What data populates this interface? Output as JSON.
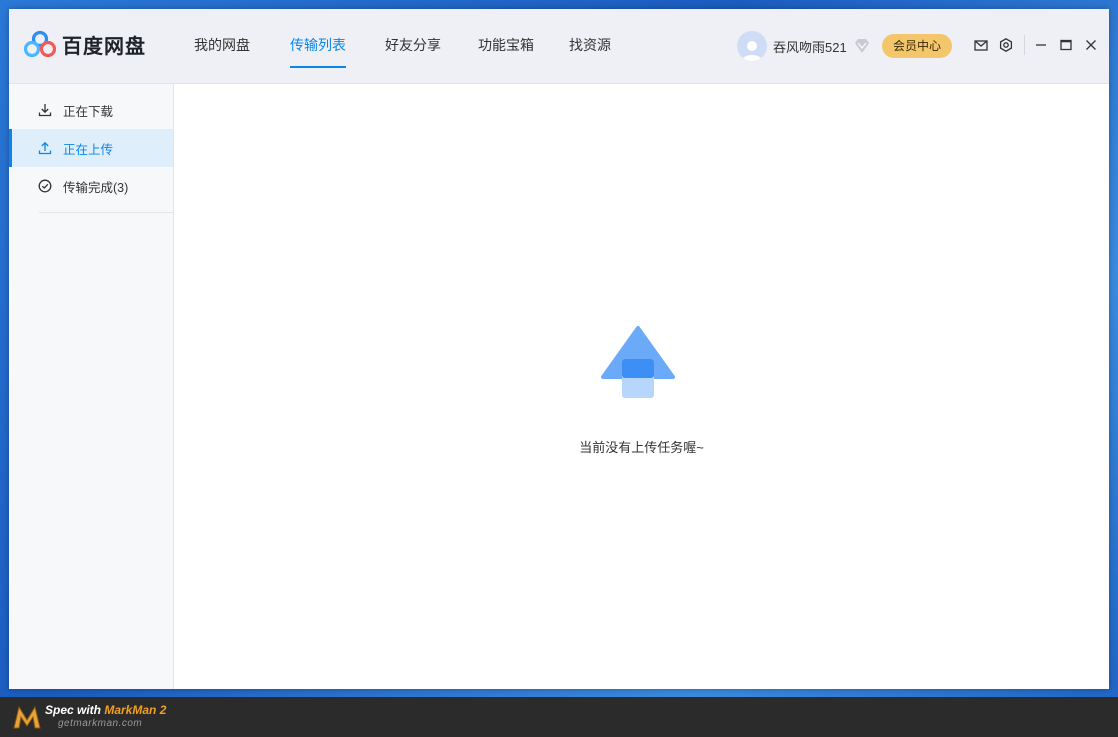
{
  "app": {
    "name": "百度网盘",
    "accent_color": "#0a86ea"
  },
  "nav": {
    "items": [
      {
        "label": "我的网盘"
      },
      {
        "label": "传输列表",
        "active": true
      },
      {
        "label": "好友分享"
      },
      {
        "label": "功能宝箱"
      },
      {
        "label": "找资源"
      }
    ]
  },
  "user": {
    "name": "吞风吻雨521",
    "vip_button": "会员中心",
    "avatar_icon": "user-avatar-icon",
    "level_icon": "diamond-icon"
  },
  "toolbar": {
    "icons": [
      "mail-icon",
      "settings-icon",
      "minimize-icon",
      "maximize-icon",
      "close-icon"
    ]
  },
  "sidebar": {
    "items": [
      {
        "label": "正在下载",
        "icon": "download-icon"
      },
      {
        "label": "正在上传",
        "icon": "upload-icon",
        "active": true
      },
      {
        "label": "传输完成(3)",
        "icon": "check-circle-icon"
      }
    ]
  },
  "main": {
    "empty_icon": "upload-arrow-icon",
    "empty_message": "当前没有上传任务喔~"
  },
  "watermark": {
    "prefix": "Spec with ",
    "brand": "MarkMan 2",
    "url": "getmarkman.com"
  }
}
